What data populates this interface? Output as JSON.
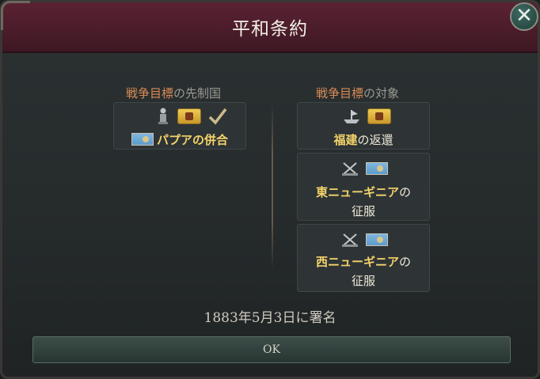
{
  "window": {
    "title": "平和条約",
    "close_label": "✕"
  },
  "left_column": {
    "heading_highlight": "戦争目標",
    "heading_rest": "の先制国",
    "goal": {
      "prefix": "",
      "name": "パプアの併合",
      "completed_mark": "✔"
    }
  },
  "right_column": {
    "heading_highlight": "戦争目標",
    "heading_rest": "の対象",
    "goals": [
      {
        "name": "福建",
        "suffix": "の返還"
      },
      {
        "name": "東ニューギニア",
        "suffix": "の",
        "line2": "征服"
      },
      {
        "name": "西ニューギニア",
        "suffix": "の",
        "line2": "征服"
      }
    ]
  },
  "footer": {
    "signed_text": "1883年5月3日に署名",
    "ok_label": "OK"
  },
  "icons": [
    "soldier-icon",
    "crest-icon",
    "check-icon",
    "flag-icon",
    "ship-icon",
    "crossed-swords-icon"
  ],
  "colors": {
    "title_bar": "#4a1c2a",
    "heading_accent": "#d98a55",
    "goal_name": "#f3d36a",
    "ok_button": "#2f3f3a"
  }
}
